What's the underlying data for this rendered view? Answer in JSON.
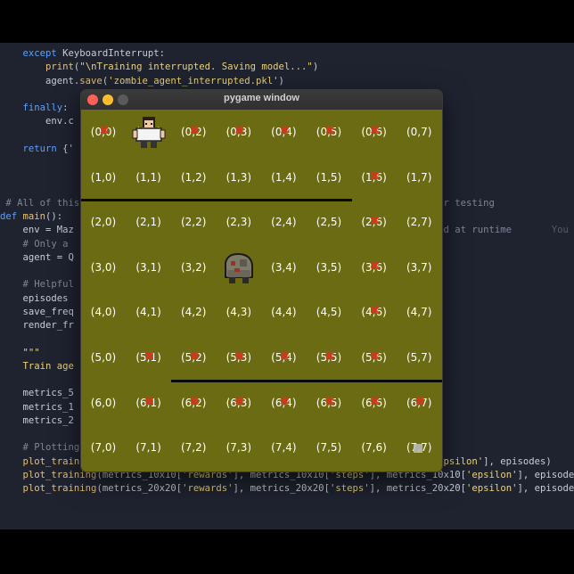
{
  "code_lines": [
    {
      "html": "    <span class=\"kw\">except</span> KeyboardInterrupt:"
    },
    {
      "html": "        <span class=\"fn\">print</span>(<span class=\"str\">\"\\nTraining interrupted. Saving model...\"</span>)"
    },
    {
      "html": "        agent.<span class=\"fn\">save</span>(<span class=\"str\">'zombie_agent_interrupted.pkl'</span>)"
    },
    {
      "html": ""
    },
    {
      "html": "    <span class=\"kw\">finally</span>:"
    },
    {
      "html": "        env.c"
    },
    {
      "html": ""
    },
    {
      "html": "    <span class=\"kw\">return</span> {'"
    },
    {
      "html": ""
    },
    {
      "html": ""
    },
    {
      "html": ""
    },
    {
      "html": " <span class=\"cm\"># All of this</span>                                                             <span class=\"cm\">ther testing</span>"
    },
    {
      "html": "<span class=\"kw\">def</span> <span class=\"fn\">main</span>():"
    },
    {
      "html": "    env = Maz                                                              <span class=\"cm\">used at runtime</span>       <span class=\"ghost\">You</span>"
    },
    {
      "html": "    <span class=\"cm\"># Only a</span>"
    },
    {
      "html": "    agent = Q"
    },
    {
      "html": ""
    },
    {
      "html": "    <span class=\"cm\"># Helpful</span>"
    },
    {
      "html": "    episodes "
    },
    {
      "html": "    save_freq"
    },
    {
      "html": "    render_fr"
    },
    {
      "html": ""
    },
    {
      "html": "    <span class=\"str\">\"\"\"</span>"
    },
    {
      "html": "    <span class=\"str\">Train age</span>"
    },
    {
      "html": ""
    },
    {
      "html": "    metrics_5"
    },
    {
      "html": "    metrics_1"
    },
    {
      "html": "    metrics_2"
    },
    {
      "html": ""
    },
    {
      "html": "    <span class=\"cm\"># Plotting the metrics</span>"
    },
    {
      "html": "    <span class=\"fn\">plot_training</span>(metrics_5x5[<span class=\"str\">'rewards'</span>], metrics_5x5[<span class=\"str\">'steps'</span>], metrics_5x5[<span class=\"str\">'epsilon'</span>], episodes)"
    },
    {
      "html": "    <span class=\"fn\">plot_training</span>(metrics_10x10[<span class=\"str\">'rewards'</span>], metrics_10x10[<span class=\"str\">'steps'</span>], metrics_10x10[<span class=\"str\">'epsilon'</span>], episodes)"
    },
    {
      "html": "    <span class=\"fn\">plot_training</span>(metrics_20x20[<span class=\"str\">'rewards'</span>], metrics_20x20[<span class=\"str\">'steps'</span>], metrics_20x20[<span class=\"str\">'epsilon'</span>], episodes)"
    }
  ],
  "window": {
    "title": "pygame window",
    "colors": {
      "close": "#ff5f57",
      "minimize": "#febc2e",
      "zoom": "#5a5a5a",
      "board": "#6b6b14"
    }
  },
  "grid": {
    "rows": 8,
    "cols": 8,
    "labels": [
      [
        "(0,0)",
        "(0,1)",
        "(0,2)",
        "(0,3)",
        "(0,4)",
        "(0,5)",
        "(0,6)",
        "(0,7)"
      ],
      [
        "(1,0)",
        "(1,1)",
        "(1,2)",
        "(1,3)",
        "(1,4)",
        "(1,5)",
        "(1,6)",
        "(1,7)"
      ],
      [
        "(2,0)",
        "(2,1)",
        "(2,2)",
        "(2,3)",
        "(2,4)",
        "(2,5)",
        "(2,6)",
        "(2,7)"
      ],
      [
        "(3,0)",
        "(3,1)",
        "(3,2)",
        "(3,3)",
        "(3,4)",
        "(3,5)",
        "(3,6)",
        "(3,7)"
      ],
      [
        "(4,0)",
        "(4,1)",
        "(4,2)",
        "(4,3)",
        "(4,4)",
        "(4,5)",
        "(4,6)",
        "(4,7)"
      ],
      [
        "(5,0)",
        "(5,1)",
        "(5,2)",
        "(5,3)",
        "(5,4)",
        "(5,5)",
        "(5,6)",
        "(5,7)"
      ],
      [
        "(6,0)",
        "(6,1)",
        "(6,2)",
        "(6,3)",
        "(6,4)",
        "(6,5)",
        "(6,6)",
        "(6,7)"
      ],
      [
        "(7,0)",
        "(7,1)",
        "(7,2)",
        "(7,3)",
        "(7,4)",
        "(7,5)",
        "(7,6)",
        "(7,7)"
      ]
    ],
    "visited_cells": [
      [
        0,
        0
      ],
      [
        0,
        2
      ],
      [
        0,
        3
      ],
      [
        0,
        4
      ],
      [
        0,
        5
      ],
      [
        0,
        6
      ],
      [
        1,
        6
      ],
      [
        2,
        6
      ],
      [
        3,
        6
      ],
      [
        4,
        6
      ],
      [
        5,
        1
      ],
      [
        5,
        2
      ],
      [
        5,
        3
      ],
      [
        5,
        4
      ],
      [
        5,
        5
      ],
      [
        5,
        6
      ],
      [
        6,
        1
      ],
      [
        6,
        2
      ],
      [
        6,
        3
      ],
      [
        6,
        4
      ],
      [
        6,
        5
      ],
      [
        6,
        6
      ],
      [
        6,
        7
      ]
    ],
    "player_cell": [
      0,
      1
    ],
    "zombie_cell": [
      3,
      3
    ],
    "goal_cell": [
      7,
      7
    ],
    "walls": [
      {
        "row_boundary": 2,
        "from_col": 0,
        "to_col": 6
      },
      {
        "row_boundary": 6,
        "from_col": 2,
        "to_col": 8
      }
    ]
  },
  "sprites": {
    "player": "person-sprite",
    "zombie": "zombie-sprite",
    "goal": "exit-marker"
  },
  "mark_symbol": "✖"
}
